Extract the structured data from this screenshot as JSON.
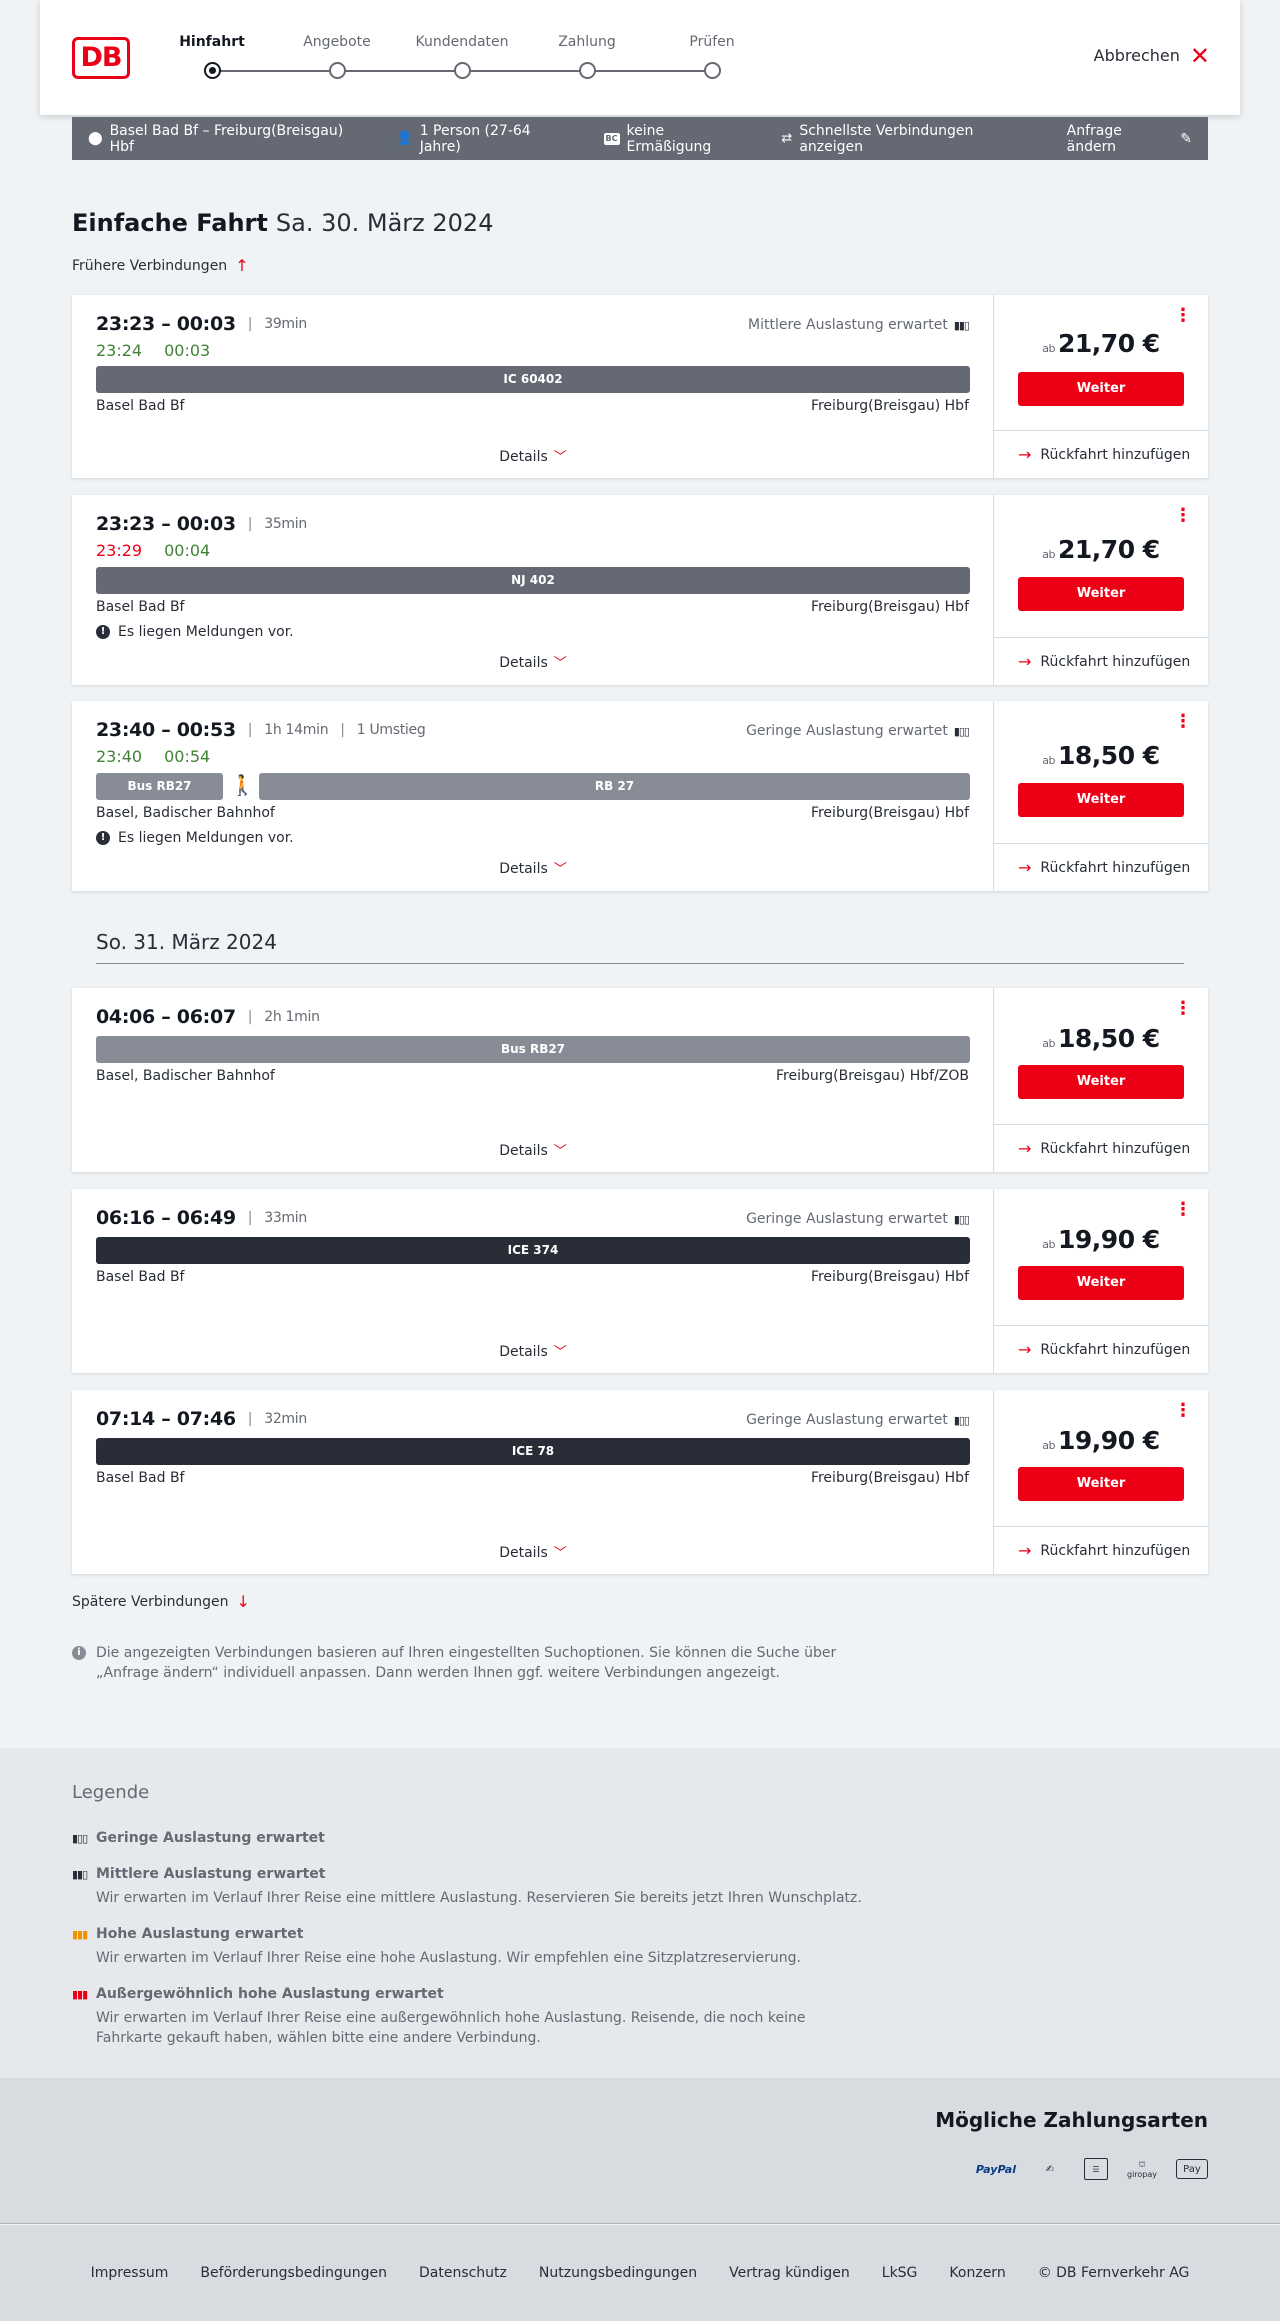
{
  "header": {
    "logo": "DB",
    "steps": [
      {
        "label": "Hinfahrt",
        "active": true
      },
      {
        "label": "Angebote",
        "active": false
      },
      {
        "label": "Kundendaten",
        "active": false
      },
      {
        "label": "Zahlung",
        "active": false
      },
      {
        "label": "Prüfen",
        "active": false
      }
    ],
    "cancel_label": "Abbrechen"
  },
  "filter": {
    "route": "Basel Bad Bf – Freiburg(Breisgau) Hbf",
    "passengers": "1 Person (27-64 Jahre)",
    "discount_badge": "BC",
    "discount": "keine Ermäßigung",
    "fastest": "Schnellste Verbindungen anzeigen",
    "change_request": "Anfrage ändern"
  },
  "main": {
    "title": "Einfache Fahrt",
    "date": "Sa. 30. März 2024",
    "earlier": "Frühere Verbindungen",
    "later": "Spätere Verbindungen",
    "second_date": "So. 31. März 2024",
    "info_note": "Die angezeigten Verbindungen basieren auf Ihren eingestellten Suchoptionen. Sie können die Suche über „Anfrage ändern“ individuell anpassen. Dann werden Ihnen ggf. weitere Verbindungen angezeigt."
  },
  "connections": [
    {
      "times": "23:23 – 00:03",
      "duration": "39min",
      "transfers": "",
      "rt_dep": "23:24",
      "rt_arr": "00:03",
      "load": "Mittlere Auslastung erwartet",
      "train": "IC 60402",
      "from": "Basel Bad Bf",
      "to": "Freiburg(Breisgau) Hbf",
      "message": "",
      "details": "Details",
      "price_prefix": "ab",
      "price": "21,70 €",
      "button": "Weiter",
      "return": "Rückfahrt hinzufügen"
    },
    {
      "times": "23:23 – 00:03",
      "duration": "35min",
      "transfers": "",
      "rt_dep": "23:29",
      "rt_arr": "00:04",
      "load": "",
      "train": "NJ 402",
      "from": "Basel Bad Bf",
      "to": "Freiburg(Breisgau) Hbf",
      "message": "Es liegen Meldungen vor.",
      "details": "Details",
      "price_prefix": "ab",
      "price": "21,70 €",
      "button": "Weiter",
      "return": "Rückfahrt hinzufügen"
    },
    {
      "times": "23:40 – 00:53",
      "duration": "1h 14min",
      "transfers": "1 Umstieg",
      "rt_dep": "23:40",
      "rt_arr": "00:54",
      "load": "Geringe Auslastung erwartet",
      "train": "Bus RB27",
      "train2": "RB 27",
      "from": "Basel, Badischer Bahnhof",
      "to": "Freiburg(Breisgau) Hbf",
      "message": "Es liegen Meldungen vor.",
      "details": "Details",
      "price_prefix": "ab",
      "price": "18,50 €",
      "button": "Weiter",
      "return": "Rückfahrt hinzufügen"
    },
    {
      "times": "04:06 – 06:07",
      "duration": "2h 1min",
      "transfers": "",
      "load": "",
      "train": "Bus RB27",
      "from": "Basel, Badischer Bahnhof",
      "to": "Freiburg(Breisgau) Hbf/ZOB",
      "details": "Details",
      "price_prefix": "ab",
      "price": "18,50 €",
      "button": "Weiter",
      "return": "Rückfahrt hinzufügen"
    },
    {
      "times": "06:16 – 06:49",
      "duration": "33min",
      "transfers": "",
      "load": "Geringe Auslastung erwartet",
      "train": "ICE 374",
      "from": "Basel Bad Bf",
      "to": "Freiburg(Breisgau) Hbf",
      "details": "Details",
      "price_prefix": "ab",
      "price": "19,90 €",
      "button": "Weiter",
      "return": "Rückfahrt hinzufügen"
    },
    {
      "times": "07:14 – 07:46",
      "duration": "32min",
      "transfers": "",
      "load": "Geringe Auslastung erwartet",
      "train": "ICE 78",
      "from": "Basel Bad Bf",
      "to": "Freiburg(Breisgau) Hbf",
      "details": "Details",
      "price_prefix": "ab",
      "price": "19,90 €",
      "button": "Weiter",
      "return": "Rückfahrt hinzufügen"
    }
  ],
  "legend": {
    "title": "Legende",
    "items": [
      {
        "title": "Geringe Auslastung erwartet",
        "desc": "",
        "color": "#282d37"
      },
      {
        "title": "Mittlere Auslastung erwartet",
        "desc": "Wir erwarten im Verlauf Ihrer Reise eine mittlere Auslastung. Reservieren Sie bereits jetzt Ihren Wunschplatz.",
        "color": "#282d37"
      },
      {
        "title": "Hohe Auslastung erwartet",
        "desc": "Wir erwarten im Verlauf Ihrer Reise eine hohe Auslastung. Wir empfehlen eine Sitzplatzreservierung.",
        "color": "#f39200"
      },
      {
        "title": "Außergewöhnlich hohe Auslastung erwartet",
        "desc": "Wir erwarten im Verlauf Ihrer Reise eine außergewöhnlich hohe Auslastung. Reisende, die noch keine Fahrkarte gekauft haben, wählen bitte eine andere Verbindung.",
        "color": "#ec0016"
      }
    ]
  },
  "payment": {
    "title": "Mögliche Zahlungsarten",
    "methods": [
      "PayPal",
      "giropay",
      "Pay"
    ]
  },
  "footer": {
    "links": [
      "Impressum",
      "Beförderungsbedingungen",
      "Datenschutz",
      "Nutzungsbedingungen",
      "Vertrag kündigen",
      "LkSG",
      "Konzern",
      "© DB Fernverkehr AG"
    ]
  },
  "colors": {
    "accent": "#ec0016",
    "on_time": "#408335",
    "delayed": "#ec0016"
  }
}
